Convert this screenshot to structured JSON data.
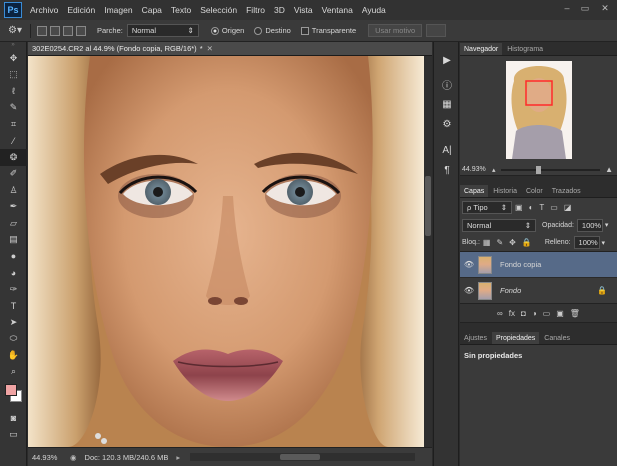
{
  "app": {
    "logo": "Ps"
  },
  "menubar": {
    "items": [
      "Archivo",
      "Edición",
      "Imagen",
      "Capa",
      "Texto",
      "Selección",
      "Filtro",
      "3D",
      "Vista",
      "Ventana",
      "Ayuda"
    ],
    "win_controls": [
      "–",
      "▭",
      "✕"
    ]
  },
  "options": {
    "patch_label": "Parche:",
    "patch_value": "Normal",
    "source_label": "Origen",
    "dest_label": "Destino",
    "transparent_label": "Transparente",
    "use_pattern_label": "Usar motivo"
  },
  "document": {
    "tab_title": "302E0254.CR2 al 44.9% (Fondo copia, RGB/16*)",
    "tab_modified": "*",
    "zoom": "44.93%",
    "doc_info": "Doc: 120.3 MB/240.6 MB"
  },
  "navigator": {
    "tabs": [
      "Navegador",
      "Histograma"
    ],
    "zoom": "44.93%"
  },
  "layers_panel": {
    "tabs": [
      "Capas",
      "Historia",
      "Color",
      "Trazados"
    ],
    "filter_label": "ρ Tipo",
    "blend_mode": "Normal",
    "opacity_label": "Opacidad:",
    "opacity_value": "100%",
    "lock_label": "Bloq.:",
    "fill_label": "Relleno:",
    "fill_value": "100%",
    "layers": [
      {
        "name": "Fondo copia",
        "selected": true,
        "italic": false
      },
      {
        "name": "Fondo",
        "selected": false,
        "italic": true
      }
    ],
    "bottom_icons": [
      "∞",
      "fx",
      "◘",
      "◑",
      "▭",
      "▣",
      "🗑"
    ]
  },
  "properties_panel": {
    "tabs": [
      "Ajustes",
      "Propiedades",
      "Canales"
    ],
    "content": "Sin propiedades"
  },
  "colors": {
    "foreground": "#f0a4a4",
    "background": "#ffffff",
    "selected_layer": "#566a88",
    "accent": "#5ab4ff"
  }
}
